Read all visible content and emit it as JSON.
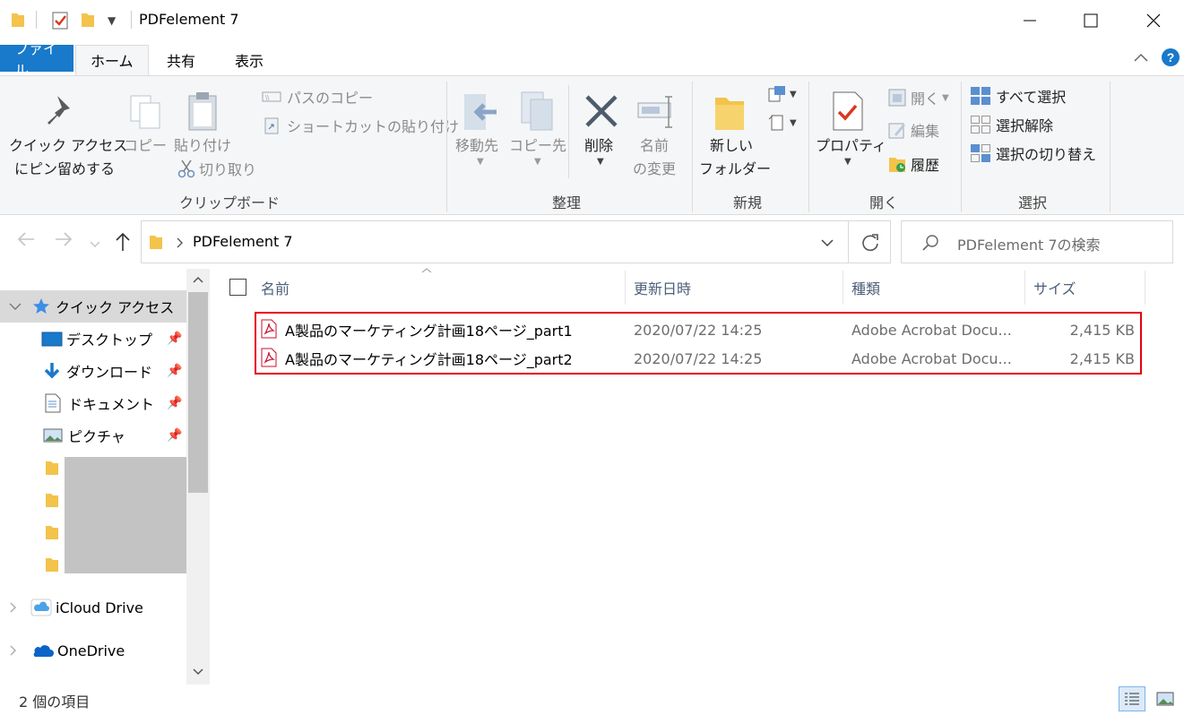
{
  "window": {
    "title": "PDFelement 7"
  },
  "tabs": {
    "file": "ファイル",
    "home": "ホーム",
    "share": "共有",
    "view": "表示"
  },
  "ribbon": {
    "clipboard": {
      "title": "クリップボード",
      "pin_line1": "クイック アクセス",
      "pin_line2": "にピン留めする",
      "copy": "コピー",
      "paste": "貼り付け",
      "copy_path": "パスのコピー",
      "paste_shortcut": "ショートカットの貼り付け",
      "cut": "切り取り"
    },
    "organize": {
      "title": "整理",
      "move_to": "移動先",
      "copy_to": "コピー先",
      "delete": "削除",
      "rename_line1": "名前",
      "rename_line2": "の変更"
    },
    "new": {
      "title": "新規",
      "new_folder_line1": "新しい",
      "new_folder_line2": "フォルダー"
    },
    "open": {
      "title": "開く",
      "properties": "プロパティ",
      "open": "開く",
      "edit": "編集",
      "history": "履歴"
    },
    "select": {
      "title": "選択",
      "select_all": "すべて選択",
      "select_none": "選択解除",
      "invert": "選択の切り替え"
    }
  },
  "address": {
    "path": "PDFelement 7"
  },
  "search": {
    "placeholder": "PDFelement 7の検索"
  },
  "nav": {
    "quick_access": "クイック アクセス",
    "items": [
      "デスクトップ",
      "ダウンロード",
      "ドキュメント",
      "ピクチャ"
    ],
    "icloud": "iCloud Drive",
    "onedrive": "OneDrive"
  },
  "columns": {
    "name": "名前",
    "date": "更新日時",
    "type": "種類",
    "size": "サイズ"
  },
  "files": [
    {
      "name": "A製品のマーケティング計画18ページ_part1",
      "date": "2020/07/22 14:25",
      "type": "Adobe Acrobat Docu...",
      "size": "2,415 KB"
    },
    {
      "name": "A製品のマーケティング計画18ページ_part2",
      "date": "2020/07/22 14:25",
      "type": "Adobe Acrobat Docu...",
      "size": "2,415 KB"
    }
  ],
  "status": {
    "count": "2 個の項目"
  },
  "colors": {
    "file_tab": "#1979ca",
    "highlight": "#e60012",
    "folder": "#f3c34b"
  }
}
